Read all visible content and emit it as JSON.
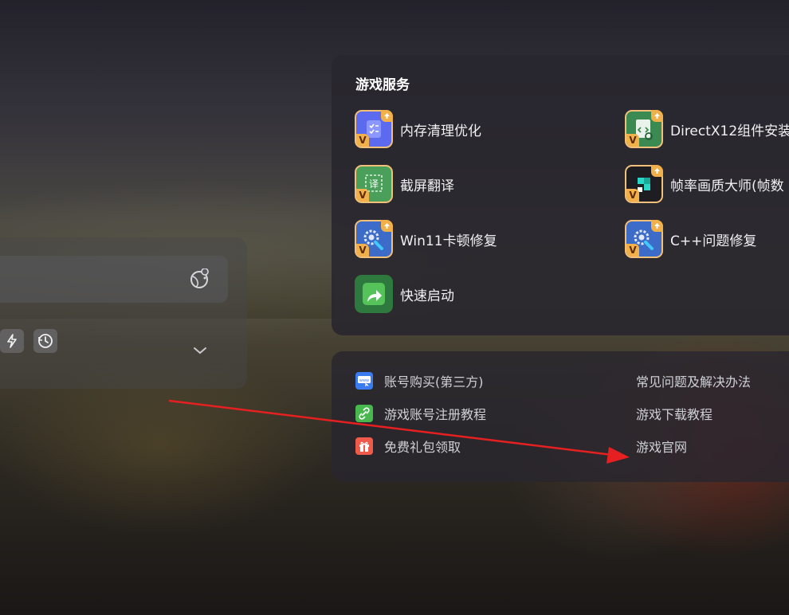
{
  "colors": {
    "panel_bg": "#2a2830",
    "accent_gold": "#f2b04a",
    "arrow_red": "#e62020",
    "text_primary": "#f0f0f2",
    "text_secondary": "#cfd0d6"
  },
  "left_panel": {
    "input_icon": "globe-pin-icon",
    "tools": [
      "boost-icon",
      "refresh-clock-icon"
    ],
    "chevron": "chevron-down-icon"
  },
  "services": {
    "title": "游戏服务",
    "items": [
      {
        "label": "内存清理优化",
        "icon": "memory-clean-icon"
      },
      {
        "label": "DirectX12组件安装",
        "icon": "directx-icon"
      },
      {
        "label": "截屏翻译",
        "icon": "screenshot-translate-icon"
      },
      {
        "label": "帧率画质大师(帧数",
        "icon": "fps-master-icon"
      },
      {
        "label": "Win11卡顿修复",
        "icon": "gear-wrench-icon"
      },
      {
        "label": "C++问题修复",
        "icon": "gear-wrench-icon"
      },
      {
        "label": "快速启动",
        "icon": "quick-launch-icon"
      }
    ],
    "vip_badge": "V"
  },
  "links": {
    "left": [
      {
        "label": "账号购买(第三方)",
        "icon": "www-icon"
      },
      {
        "label": "游戏账号注册教程",
        "icon": "link-icon"
      },
      {
        "label": "免费礼包领取",
        "icon": "gift-icon"
      }
    ],
    "right": [
      {
        "label": "常见问题及解决办法"
      },
      {
        "label": "游戏下载教程"
      },
      {
        "label": "游戏官网"
      }
    ]
  }
}
